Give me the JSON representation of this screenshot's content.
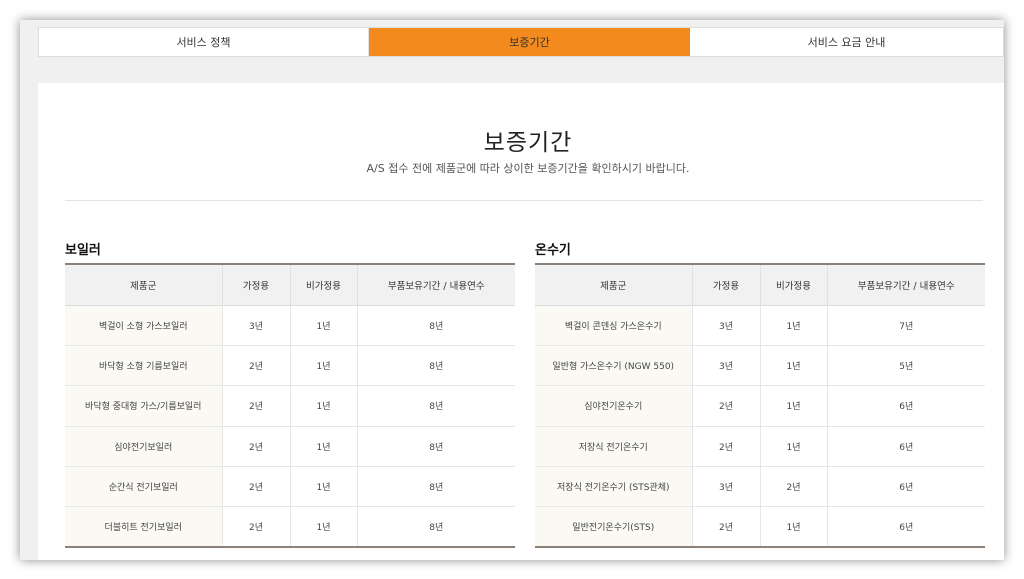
{
  "tabs": [
    {
      "label": "서비스 정책",
      "active": false
    },
    {
      "label": "보증기간",
      "active": true
    },
    {
      "label": "서비스 요금 안내",
      "active": false
    }
  ],
  "colors": {
    "active_tab": "#f28a1d",
    "table_rule": "#8b8178",
    "header_bg": "#f1f1f1",
    "name_cell_bg": "#faf9f3"
  },
  "header": {
    "title": "보증기간",
    "subtitle": "A/S 접수 전에 제품군에 따라 상이한 보증기간을 확인하시기 바랍니다."
  },
  "columns": [
    "제품군",
    "가정용",
    "비가정용",
    "부품보유기간 / 내용연수"
  ],
  "boiler": {
    "title": "보일러",
    "rows": [
      [
        "벽걸이 소형 가스보일러",
        "3년",
        "1년",
        "8년"
      ],
      [
        "바닥형 소형 기름보일러",
        "2년",
        "1년",
        "8년"
      ],
      [
        "바닥형 중대형 가스/기름보일러",
        "2년",
        "1년",
        "8년"
      ],
      [
        "심야전기보일러",
        "2년",
        "1년",
        "8년"
      ],
      [
        "순간식 전기보일러",
        "2년",
        "1년",
        "8년"
      ],
      [
        "더블히트 전기보일러",
        "2년",
        "1년",
        "8년"
      ]
    ]
  },
  "heater": {
    "title": "온수기",
    "rows": [
      [
        "벽걸이 콘덴싱 가스온수기",
        "3년",
        "1년",
        "7년"
      ],
      [
        "일반형 가스온수기 (NGW 550)",
        "3년",
        "1년",
        "5년"
      ],
      [
        "심야전기온수기",
        "2년",
        "1년",
        "6년"
      ],
      [
        "저장식 전기온수기",
        "2년",
        "1년",
        "6년"
      ],
      [
        "저장식 전기온수기 (STS관체)",
        "3년",
        "2년",
        "6년"
      ],
      [
        "일반전기온수기(STS)",
        "2년",
        "1년",
        "6년"
      ]
    ]
  }
}
